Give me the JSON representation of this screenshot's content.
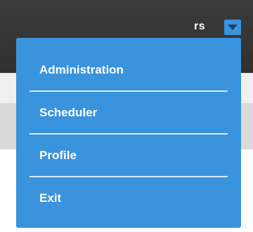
{
  "header": {
    "user_name": "rs",
    "dropdown_icon": "caret-down-icon"
  },
  "user_menu": {
    "items": [
      {
        "label": "Administration"
      },
      {
        "label": "Scheduler"
      },
      {
        "label": "Profile"
      },
      {
        "label": "Exit"
      }
    ]
  },
  "colors": {
    "topbar": "#333333",
    "menu_background": "#3a93dd",
    "menu_text": "#ffffff"
  }
}
